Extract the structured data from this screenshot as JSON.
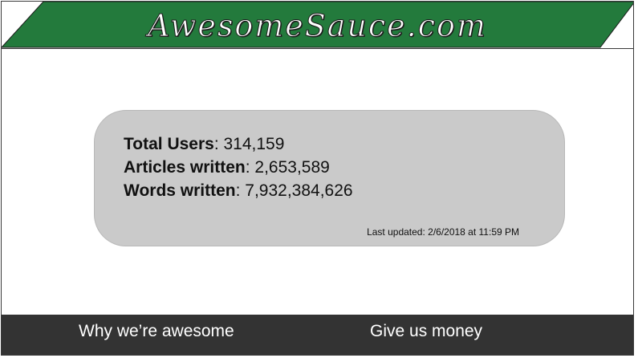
{
  "header": {
    "logo_text": "AwesomeSauce.com",
    "band_color": "#237a3c"
  },
  "stats": {
    "total_users_label": "Total Users",
    "total_users_value": ": 314,159",
    "articles_label": "Articles written",
    "articles_value": ": 2,653,589",
    "words_label": "Words written",
    "words_value": ": 7,932,384,626",
    "last_updated": "Last updated: 2/6/2018 at 11:59 PM"
  },
  "footer": {
    "link_1": "Why we’re awesome",
    "link_2": "Give us money",
    "background": "#333333"
  }
}
